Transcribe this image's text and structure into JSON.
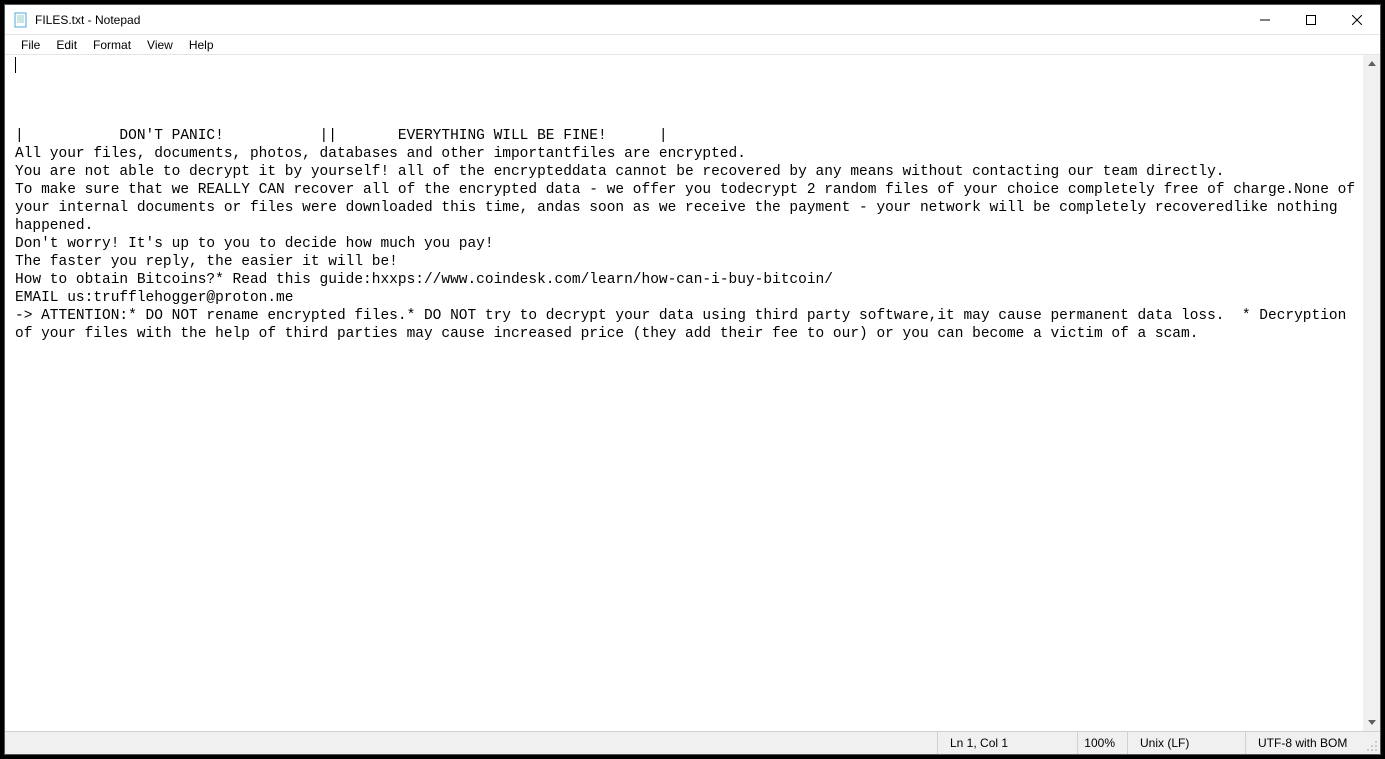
{
  "window": {
    "title": "FILES.txt - Notepad"
  },
  "menu": {
    "file": "File",
    "edit": "Edit",
    "format": "Format",
    "view": "View",
    "help": "Help"
  },
  "document": {
    "lines": [
      "",
      "|           DON'T PANIC!           ||       EVERYTHING WILL BE FINE!      |",
      "All your files, documents, photos, databases and other importantfiles are encrypted.",
      "You are not able to decrypt it by yourself! all of the encrypteddata cannot be recovered by any means without contacting our team directly.",
      "To make sure that we REALLY CAN recover all of the encrypted data - we offer you todecrypt 2 random files of your choice completely free of charge.None of your internal documents or files were downloaded this time, andas soon as we receive the payment - your network will be completely recoveredlike nothing happened.",
      "Don't worry! It's up to you to decide how much you pay!",
      "The faster you reply, the easier it will be!",
      "How to obtain Bitcoins?* Read this guide:hxxps://www.coindesk.com/learn/how-can-i-buy-bitcoin/",
      "EMAIL us:trufflehogger@proton.me",
      "-> ATTENTION:* DO NOT rename encrypted files.* DO NOT try to decrypt your data using third party software,it may cause permanent data loss.  * Decryption of your files with the help of third parties may cause increased price (they add their fee to our) or you can become a victim of a scam."
    ]
  },
  "statusbar": {
    "position": "Ln 1, Col 1",
    "zoom": "100%",
    "line_ending": "Unix (LF)",
    "encoding": "UTF-8 with BOM"
  }
}
